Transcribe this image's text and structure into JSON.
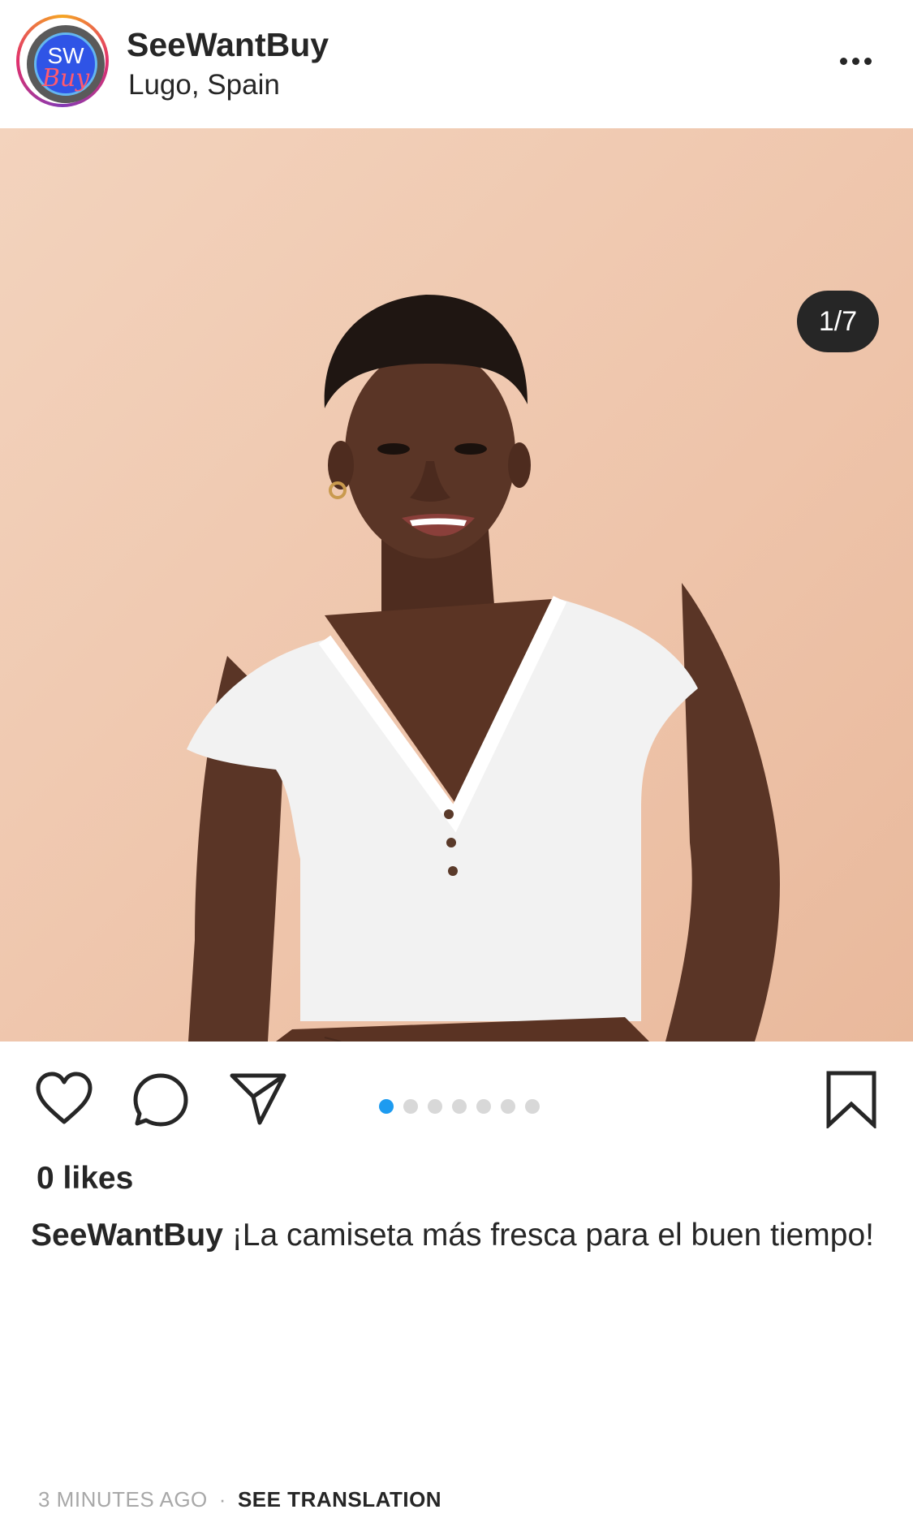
{
  "header": {
    "avatar_text_top": "SW",
    "avatar_text_bottom": "Buy",
    "username": "SeeWantBuy",
    "location": "Lugo, Spain",
    "more_icon": "more-horizontal-icon"
  },
  "photo": {
    "counter": "1/7",
    "background_color": "#eec4aa",
    "carousel_total": 7,
    "carousel_active_index": 0
  },
  "actions": {
    "like_icon": "heart-icon",
    "comment_icon": "comment-bubble-icon",
    "share_icon": "paper-plane-icon",
    "save_icon": "bookmark-icon",
    "active_dot_color": "#1d9bf0"
  },
  "likes": "0 likes",
  "caption": {
    "username": "SeeWantBuy",
    "text": "¡La camiseta más fresca para el buen tiempo!"
  },
  "footer": {
    "time": "3 MINUTES AGO",
    "separator": "·",
    "translate_label": "SEE TRANSLATION"
  }
}
